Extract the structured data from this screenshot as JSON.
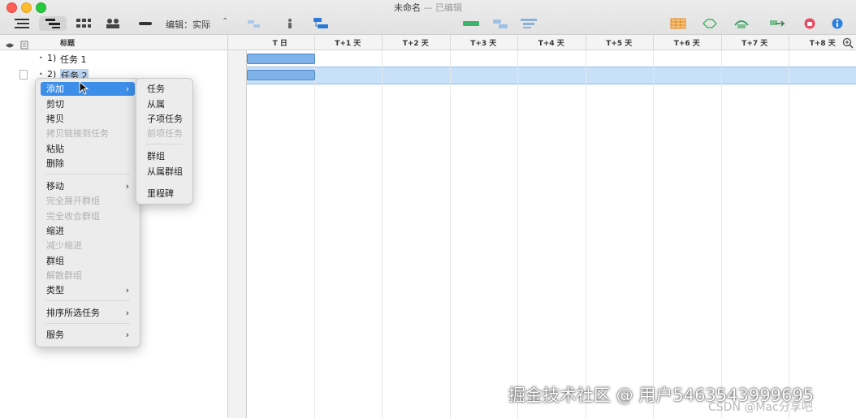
{
  "window": {
    "title": "未命名",
    "title_separator": "—",
    "status": "已编辑"
  },
  "toolbar": {
    "icons": [
      "sidebar-icon",
      "outline-view-icon",
      "network-view-icon",
      "resource-view-icon",
      "styles-icon",
      "baseline-icon",
      "split-icon",
      "flow-icon",
      "gantt-chart-icon",
      "add-task-icon",
      "add-group-icon",
      "reveal-icon",
      "resource-table-icon",
      "level-icon",
      "inspectors-icon",
      "shortcuts-icon",
      "stop-icon",
      "info-icon"
    ],
    "edit_label": "编辑：实际",
    "edit_chevron": "⌃"
  },
  "columns": {
    "title": "标题"
  },
  "timeline": {
    "days": [
      "T 日",
      "T+1 天",
      "T+2 天",
      "T+3 天",
      "T+4 天",
      "T+5 天",
      "T+6 天",
      "T+7 天",
      "T+8 天"
    ]
  },
  "tasks": [
    {
      "number": "1)",
      "name": "任务 1",
      "bullet": "•",
      "bar_start_day": 0,
      "bar_duration_days": 1,
      "selected": false
    },
    {
      "number": "2)",
      "name": "任务 2",
      "bullet": "•",
      "bar_start_day": 0,
      "bar_duration_days": 1,
      "selected": true
    }
  ],
  "context_menu": {
    "items": [
      {
        "label": "添加",
        "enabled": true,
        "submenu": true,
        "highlighted": true
      },
      {
        "label": "剪切",
        "enabled": true
      },
      {
        "label": "拷贝",
        "enabled": true
      },
      {
        "label": "拷贝链接到任务",
        "enabled": false
      },
      {
        "label": "粘贴",
        "enabled": true
      },
      {
        "label": "删除",
        "enabled": true
      },
      {
        "label": "移动",
        "enabled": true,
        "submenu": true
      },
      {
        "label": "完全展开群组",
        "enabled": false
      },
      {
        "label": "完全收合群组",
        "enabled": false
      },
      {
        "label": "缩进",
        "enabled": true
      },
      {
        "label": "减少缩进",
        "enabled": false
      },
      {
        "label": "群组",
        "enabled": true
      },
      {
        "label": "解散群组",
        "enabled": false
      },
      {
        "label": "类型",
        "enabled": true,
        "submenu": true
      },
      {
        "label": "排序所选任务",
        "enabled": true,
        "submenu": true
      },
      {
        "label": "服务",
        "enabled": true,
        "submenu": true
      }
    ],
    "submenu_arrow": "›"
  },
  "add_submenu": {
    "items": [
      {
        "label": "任务",
        "enabled": true
      },
      {
        "label": "从属",
        "enabled": true
      },
      {
        "label": "子项任务",
        "enabled": true
      },
      {
        "label": "前项任务",
        "enabled": false
      },
      {
        "label": "群组",
        "enabled": true
      },
      {
        "label": "从属群组",
        "enabled": true
      },
      {
        "label": "里程碑",
        "enabled": true
      }
    ]
  },
  "watermark": {
    "main": "掘金技术社区 @ 用户5463543999695",
    "secondary": "CSDN @Mac分享吧"
  },
  "colors": {
    "selection": "#c9e1f8",
    "bar": "#7eb2e8",
    "menu_highlight": "#3d8ee8"
  }
}
